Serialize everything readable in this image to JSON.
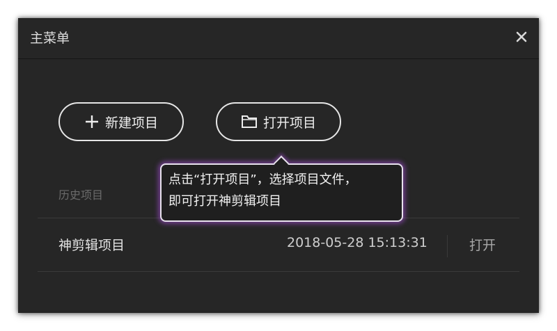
{
  "dialog": {
    "title": "主菜单",
    "close_icon": "close-icon"
  },
  "actions": {
    "new_project": {
      "label": "新建项目",
      "icon": "plus-icon"
    },
    "open_project": {
      "label": "打开项目",
      "icon": "folder-icon"
    }
  },
  "history": {
    "label": "历史项目",
    "items": [
      {
        "name": "神剪辑项目",
        "time": "2018-05-28 15:13:31",
        "action": "打开"
      }
    ]
  },
  "tooltip": {
    "line1": "点击“打开项目”，选择项目文件，",
    "line2": "即可打开神剪辑项目"
  },
  "colors": {
    "panel": "#262626",
    "border_light": "#e6e6e6",
    "tooltip_glow": "#aa50dc"
  }
}
